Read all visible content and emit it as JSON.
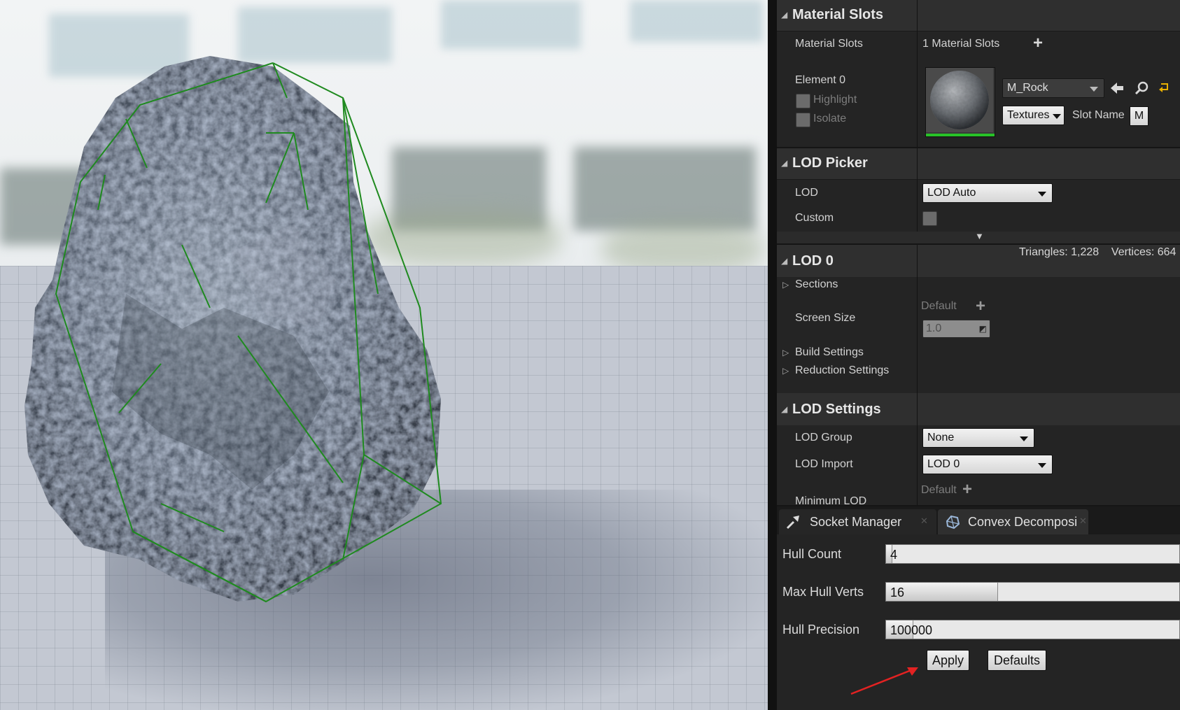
{
  "material_slots": {
    "category_title": "Material Slots",
    "label": "Material Slots",
    "count_text": "1 Material Slots",
    "element_label": "Element 0",
    "highlight_label": "Highlight",
    "isolate_label": "Isolate",
    "material_name": "M_Rock",
    "textures_label": "Textures",
    "slot_name_label": "Slot Name",
    "slot_name_value": "M"
  },
  "lod_picker": {
    "category_title": "LOD Picker",
    "lod_label": "LOD",
    "lod_value": "LOD Auto",
    "custom_label": "Custom"
  },
  "lod0": {
    "category_title": "LOD 0",
    "stats": "Triangles: 1,228    Vertices: 664",
    "sections_label": "Sections",
    "screen_size_label": "Screen Size",
    "default_label": "Default",
    "screen_size_value": "1.0",
    "build_settings_label": "Build Settings",
    "reduction_settings_label": "Reduction Settings"
  },
  "lod_settings": {
    "category_title": "LOD Settings",
    "lod_group_label": "LOD Group",
    "lod_group_value": "None",
    "lod_import_label": "LOD Import",
    "lod_import_value": "LOD 0",
    "default_label": "Default",
    "minimum_lod_label": "Minimum LOD"
  },
  "tabs": [
    {
      "label": "Socket Manager"
    },
    {
      "label": "Convex Decomposi"
    }
  ],
  "convex": {
    "hull_count_label": "Hull Count",
    "hull_count_value": "4",
    "hull_count_fraction": 0.02,
    "max_hull_verts_label": "Max Hull Verts",
    "max_hull_verts_value": "16",
    "max_hull_verts_fraction": 0.38,
    "hull_precision_label": "Hull Precision",
    "hull_precision_value": "100000",
    "hull_precision_fraction": 0.09,
    "apply_label": "Apply",
    "defaults_label": "Defaults"
  },
  "icons": [
    "plus-icon",
    "back-arrow-icon",
    "search-icon",
    "reset-icon",
    "socket-icon",
    "convex-icon",
    "close-icon",
    "expand-arrow-icon"
  ]
}
